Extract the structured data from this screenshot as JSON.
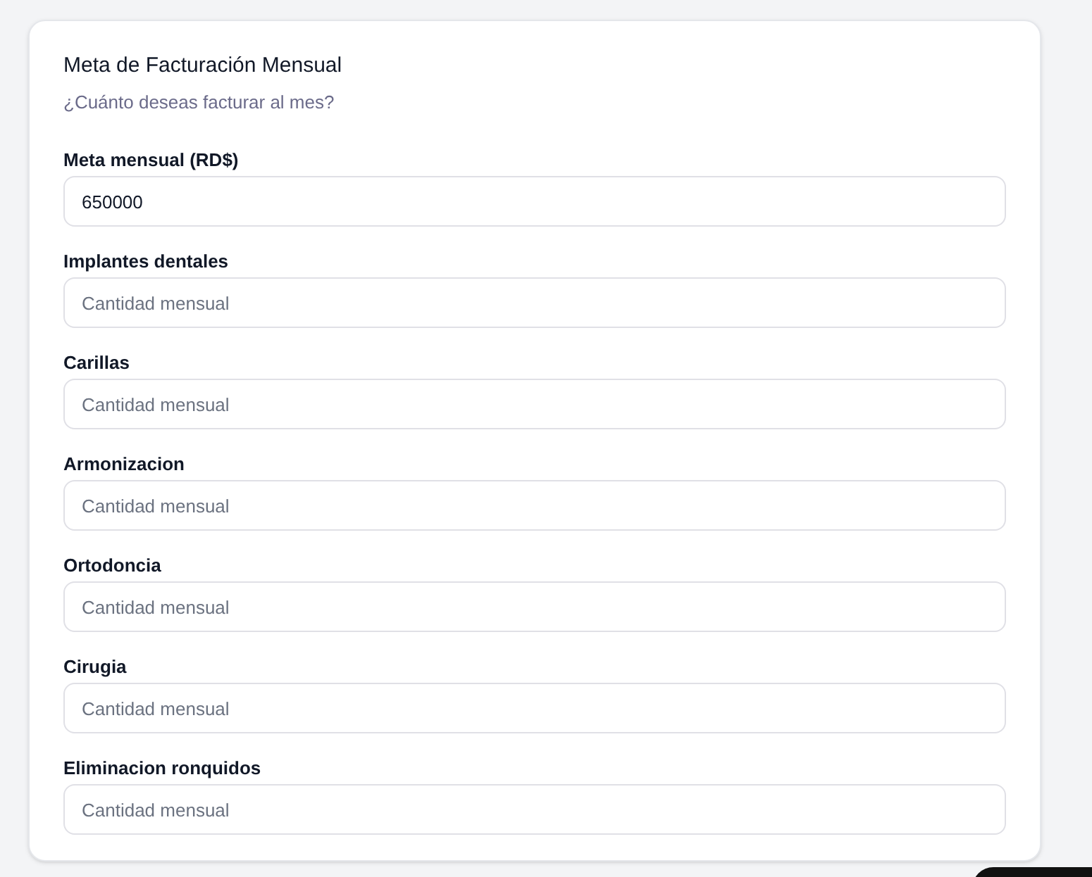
{
  "card": {
    "title": "Meta de Facturación Mensual",
    "subtitle": "¿Cuánto deseas facturar al mes?",
    "fields": [
      {
        "label": "Meta mensual (RD$)",
        "value": "650000"
      },
      {
        "label": "Implantes dentales",
        "placeholder": "Cantidad mensual"
      },
      {
        "label": "Carillas",
        "placeholder": "Cantidad mensual"
      },
      {
        "label": "Armonizacion",
        "placeholder": "Cantidad mensual"
      },
      {
        "label": "Ortodoncia",
        "placeholder": "Cantidad mensual"
      },
      {
        "label": "Cirugia",
        "placeholder": "Cantidad mensual"
      },
      {
        "label": "Eliminacion ronquidos",
        "placeholder": "Cantidad mensual"
      }
    ]
  }
}
